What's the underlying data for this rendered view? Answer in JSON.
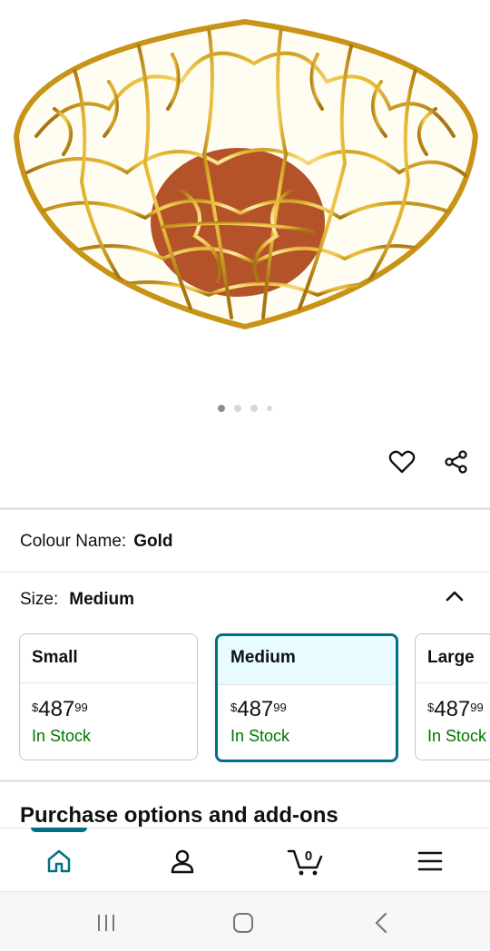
{
  "product": {
    "image_alt": "Gold coral-pattern decorative bowl",
    "carousel": {
      "total": 4,
      "active_index": 0
    }
  },
  "icons": {
    "wishlist": "heart-icon",
    "share": "share-icon",
    "collapse": "chevron-up-icon",
    "home": "home-icon",
    "account": "account-icon",
    "cart": "cart-icon",
    "menu": "menu-icon",
    "recents": "recents-icon",
    "home_system": "system-home-icon",
    "back": "back-icon"
  },
  "variations": {
    "colour_label": "Colour Name:",
    "colour_value": "Gold",
    "size_label": "Size:",
    "size_value": "Medium",
    "sizes": [
      {
        "name": "Small",
        "currency": "$",
        "whole": "487",
        "fraction": "99",
        "stock": "In Stock",
        "selected": false
      },
      {
        "name": "Medium",
        "currency": "$",
        "whole": "487",
        "fraction": "99",
        "stock": "In Stock",
        "selected": true
      },
      {
        "name": "Large",
        "currency": "$",
        "whole": "487",
        "fraction": "99",
        "stock": "In Stock",
        "selected": false
      }
    ]
  },
  "purchase_options": {
    "title": "Purchase options and add-ons"
  },
  "cart": {
    "count": "0"
  },
  "colors": {
    "accent": "#007185",
    "in_stock": "#007600",
    "bowl_gold": "#d9a521",
    "bowl_base": "#b4532a"
  }
}
